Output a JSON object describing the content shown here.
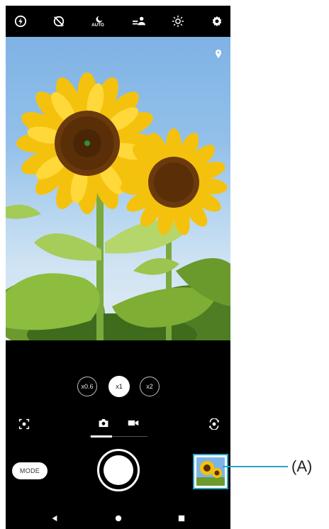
{
  "top_bar": {
    "icons": [
      "flash-icon",
      "self-timer-icon",
      "auto-mode-icon",
      "bokeh-icon",
      "brightness-icon",
      "settings-icon"
    ]
  },
  "viewfinder": {
    "location_icon": "location-icon"
  },
  "zoom": {
    "options": [
      {
        "label": "x0.6",
        "active": false
      },
      {
        "label": "x1",
        "active": true
      },
      {
        "label": "x2",
        "active": false
      }
    ]
  },
  "controls": {
    "mode_label": "MODE",
    "photo_tab_icon": "camera-icon",
    "video_tab_icon": "video-icon",
    "lens_icon": "focus-lens-icon",
    "switch_camera_icon": "switch-camera-icon",
    "shutter_icon": "shutter-button"
  },
  "nav": {
    "icons": [
      "back-icon",
      "home-icon",
      "recents-icon"
    ]
  },
  "callout": {
    "label": "(A)",
    "color": "#2aa3c9"
  },
  "colors": {
    "background": "#000000",
    "accent": "#2aa3c9"
  }
}
